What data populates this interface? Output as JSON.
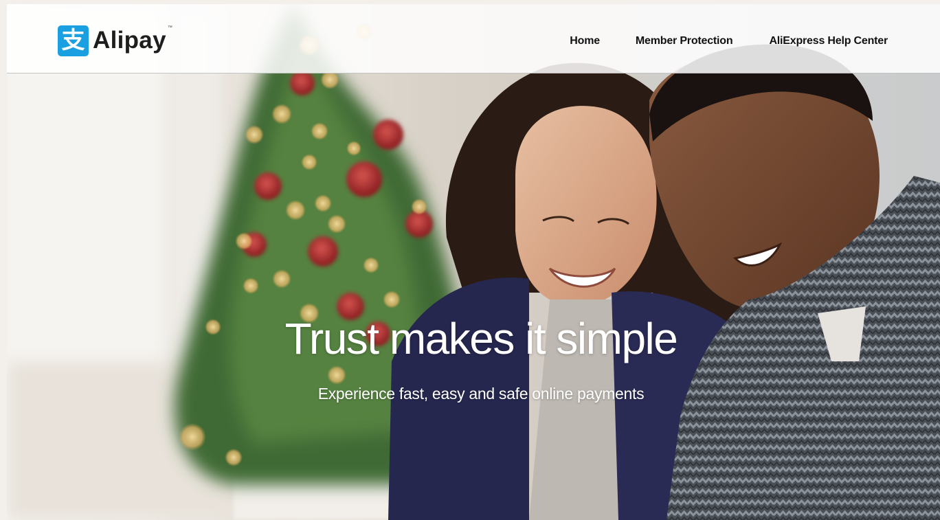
{
  "header": {
    "logo_text": "Alipay",
    "logo_mark": "支",
    "logo_tm": "™",
    "nav": [
      "Home",
      "Member Protection",
      "AliExpress Help Center"
    ]
  },
  "hero": {
    "headline": "Trust makes it simple",
    "subheadline": "Experience fast, easy and safe online payments",
    "image": "couple-smiling-christmas-tree-photo"
  },
  "colors": {
    "brand_blue": "#1a9fe0",
    "nav_text": "#111111",
    "hero_text": "#ffffff"
  }
}
